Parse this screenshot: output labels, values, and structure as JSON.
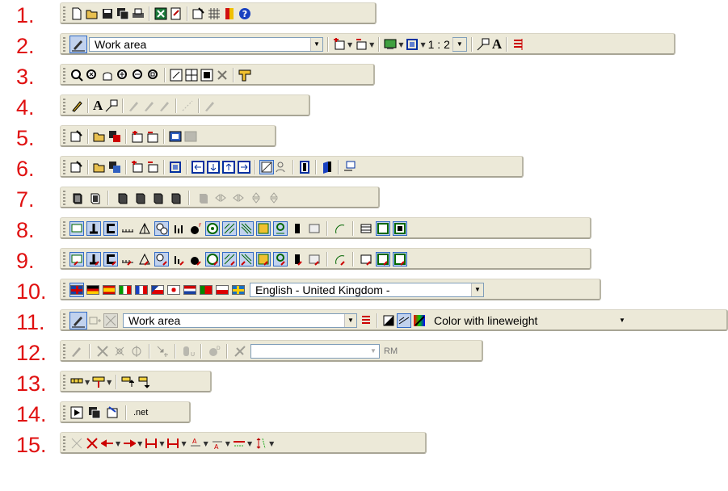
{
  "rows": [
    {
      "num": "1."
    },
    {
      "num": "2."
    },
    {
      "num": "3."
    },
    {
      "num": "4."
    },
    {
      "num": "5."
    },
    {
      "num": "6."
    },
    {
      "num": "7."
    },
    {
      "num": "8."
    },
    {
      "num": "9."
    },
    {
      "num": "10."
    },
    {
      "num": "11."
    },
    {
      "num": "12."
    },
    {
      "num": "13."
    },
    {
      "num": "14."
    },
    {
      "num": "15."
    }
  ],
  "row2": {
    "work_area": "Work area",
    "scale": "1 : 2",
    "text_a": "A"
  },
  "row4": {
    "text_a": "A"
  },
  "row10": {
    "language": "English - United Kingdom -"
  },
  "row11": {
    "work_area": "Work area",
    "pen_mode": "Color with lineweight"
  },
  "row12": {
    "rm": "RM"
  },
  "row14": {
    "net": ".net"
  },
  "colors": {
    "number_red": "#e01010",
    "toolbar_bg": "#ece9d8",
    "select_blue": "#316ac5"
  }
}
